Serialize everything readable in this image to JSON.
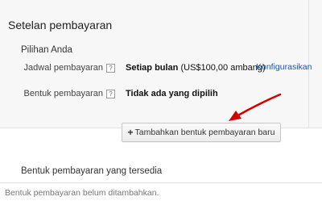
{
  "settings": {
    "title": "Setelan pembayaran",
    "subsection": "Pilihan Anda",
    "schedule": {
      "label": "Jadwal pembayaran",
      "help": "?",
      "value_bold": "Setiap bulan",
      "value_rest": " (US$100,00 ambang)",
      "link": "Konfigurasikan"
    },
    "method": {
      "label": "Bentuk pembayaran",
      "help": "?",
      "value": "Tidak ada yang dipilih"
    },
    "add_button": {
      "icon": "+",
      "label": "Tambahkan bentuk pembayaran baru"
    }
  },
  "available": {
    "title": "Bentuk pembayaran yang tersedia",
    "empty_text": "Bentuk pembayaran belum ditambahkan."
  },
  "annotation": {
    "arrow_color": "#d40000"
  }
}
